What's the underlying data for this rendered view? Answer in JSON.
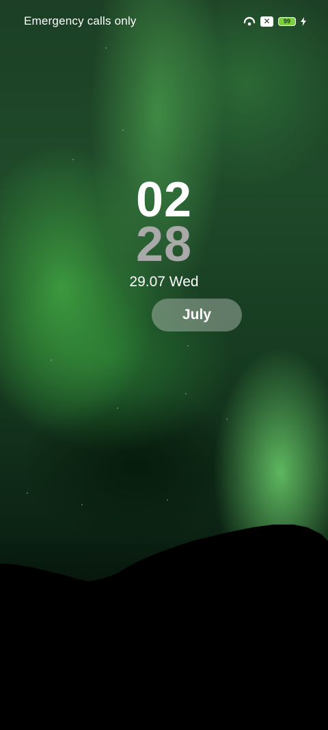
{
  "status_bar": {
    "carrier_text": "Emergency calls only",
    "icons": [
      "hotspot-icon",
      "x-icon",
      "battery-icon",
      "charging-bolt-icon"
    ],
    "battery_level": "99",
    "battery_color": "#7ccf3e"
  },
  "lockscreen": {
    "hours": "02",
    "minutes": "28",
    "date": "29.07 Wed",
    "month_label": "July"
  }
}
